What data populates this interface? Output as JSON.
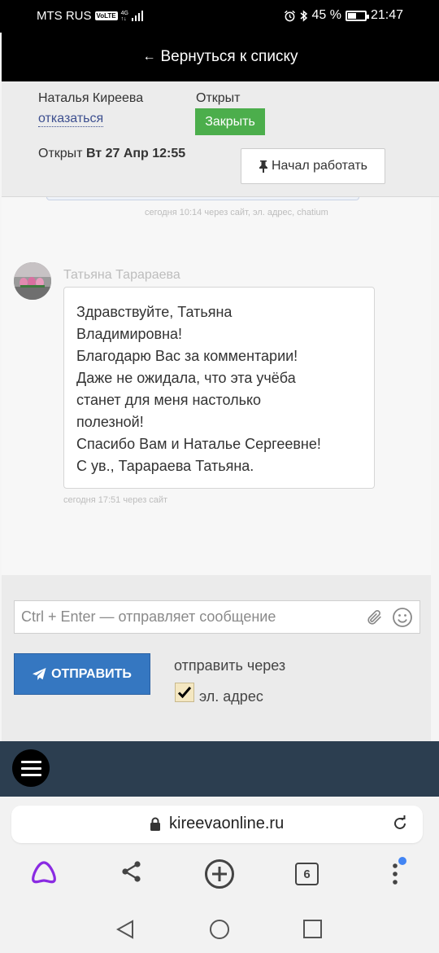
{
  "status_bar": {
    "carrier": "MTS RUS",
    "volte": "VoLTE",
    "network": "4G",
    "battery": "45 %",
    "time": "21:47"
  },
  "nav": {
    "back_label": "Вернуться к списку"
  },
  "ticket": {
    "assignee": "Наталья Киреева",
    "refuse_label": "отказаться",
    "status_label": "Открыт",
    "close_label": "Закрыть",
    "opened_prefix": "Открыт",
    "opened_date": "Вт 27 Апр 12:55",
    "start_work_label": "Начал работать"
  },
  "previous_message": {
    "meta": "сегодня 10:14 через сайт, эл. адрес, chatium"
  },
  "message": {
    "author": "Татьяна Тарараева",
    "lines": [
      "Здравствуйте, Татьяна",
      "Владимировна!",
      "Благодарю Вас за комментарии!",
      "Даже не ожидала, что эта учёба",
      "станет для меня настолько",
      "полезной!",
      "Спасибо Вам и Наталье Сергеевне!",
      "С ув., Тарараева Татьяна."
    ],
    "meta": "сегодня 17:51 через сайт"
  },
  "composer": {
    "placeholder": "Ctrl + Enter — отправляет сообщение",
    "send_label": "ОТПРАВИТЬ",
    "send_via_label": "отправить через",
    "email_label": "эл. адрес",
    "email_checked": true
  },
  "browser": {
    "url": "kireevaonline.ru",
    "tabs_count": "6"
  },
  "colors": {
    "close_green": "#4cae4c",
    "send_blue": "#3577c1",
    "dark_bar": "#2c3e50"
  }
}
